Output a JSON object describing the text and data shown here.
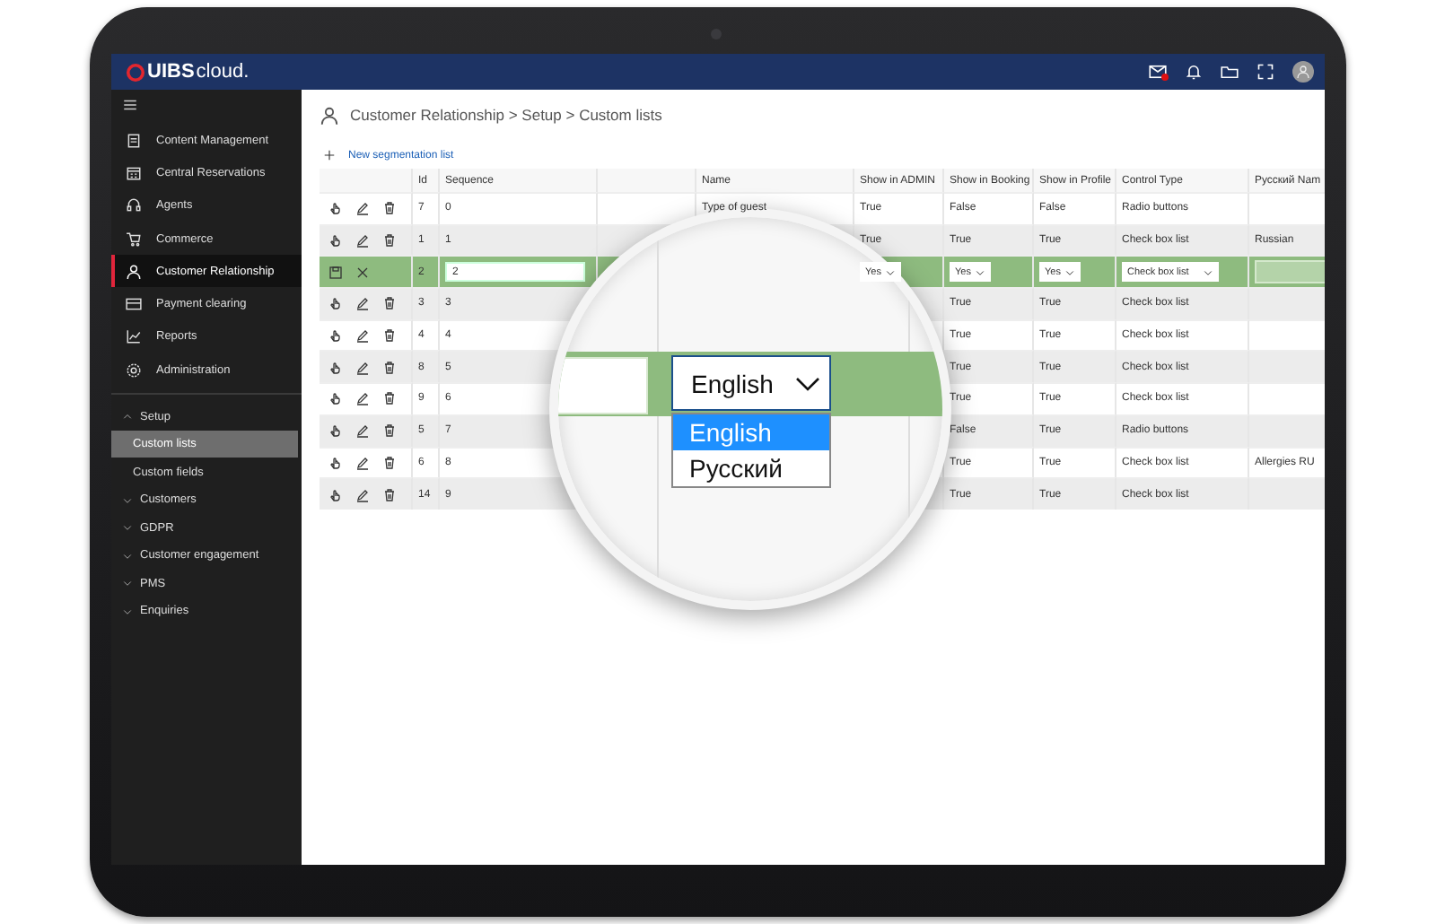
{
  "top_bar": {
    "logo": {
      "brand": "UIBS",
      "suffix": "cloud."
    },
    "mail_unread": true
  },
  "sidebar": {
    "items": [
      {
        "label": "Content Management",
        "selected": false
      },
      {
        "label": "Central Reservations",
        "selected": false
      },
      {
        "label": "Agents",
        "selected": false
      },
      {
        "label": "Commerce",
        "selected": false
      },
      {
        "label": "Customer Relationship",
        "selected": true
      },
      {
        "label": "Payment clearing",
        "selected": false
      },
      {
        "label": "Reports",
        "selected": false
      },
      {
        "label": "Administration",
        "selected": false
      }
    ],
    "tree": [
      {
        "label": "Setup",
        "expanded": true,
        "children": [
          {
            "label": "Custom lists",
            "selected": true
          },
          {
            "label": "Custom fields",
            "selected": false
          }
        ]
      },
      {
        "label": "Customers",
        "expanded": false
      },
      {
        "label": "GDPR",
        "expanded": false
      },
      {
        "label": "Customer engagement",
        "expanded": false
      },
      {
        "label": "PMS",
        "expanded": false
      },
      {
        "label": "Enquiries",
        "expanded": false
      }
    ]
  },
  "breadcrumb": "Customer Relationship >  Setup > Custom lists",
  "new_link": "New segmentation list",
  "table": {
    "columns": [
      "Id",
      "Sequence",
      "Name",
      "Show in ADMIN",
      "Show in Booking",
      "Show in Profile",
      "Control Type",
      "Русский Nam"
    ],
    "rows": [
      {
        "kind": "view",
        "id": "7",
        "sequence": "0",
        "name": "Type of guest",
        "admin": "True",
        "booking": "False",
        "profile": "False",
        "control": "Radio buttons"
      },
      {
        "kind": "view",
        "id": "1",
        "sequence": "1",
        "admin": "True",
        "booking": "True",
        "profile": "True",
        "control": "Check box list",
        "russian": "Russian"
      },
      {
        "kind": "edit",
        "id": "2",
        "sequence": "2",
        "admin": "Yes",
        "booking": "Yes",
        "profile": "Yes",
        "control": "Check box list"
      },
      {
        "kind": "view",
        "id": "3",
        "sequence": "3",
        "booking": "True",
        "profile": "True",
        "control": "Check box list"
      },
      {
        "kind": "view",
        "id": "4",
        "sequence": "4",
        "booking": "True",
        "profile": "True",
        "control": "Check box list"
      },
      {
        "kind": "view",
        "id": "8",
        "sequence": "5",
        "booking": "True",
        "profile": "True",
        "control": "Check box list"
      },
      {
        "kind": "view",
        "id": "9",
        "sequence": "6",
        "booking": "True",
        "profile": "True",
        "control": "Check box list"
      },
      {
        "kind": "view",
        "id": "5",
        "sequence": "7",
        "booking": "False",
        "profile": "True",
        "control": "Radio buttons"
      },
      {
        "kind": "view",
        "id": "6",
        "sequence": "8",
        "booking": "True",
        "profile": "True",
        "control": "Check box list",
        "russian": "Allergies RU"
      },
      {
        "kind": "view",
        "id": "14",
        "sequence": "9",
        "booking": "True",
        "profile": "True",
        "control": "Check box list"
      }
    ]
  },
  "magnifier": {
    "select": {
      "value": "English"
    },
    "options": [
      {
        "label": "English",
        "selected": true
      },
      {
        "label": "Русский",
        "selected": false
      }
    ]
  }
}
